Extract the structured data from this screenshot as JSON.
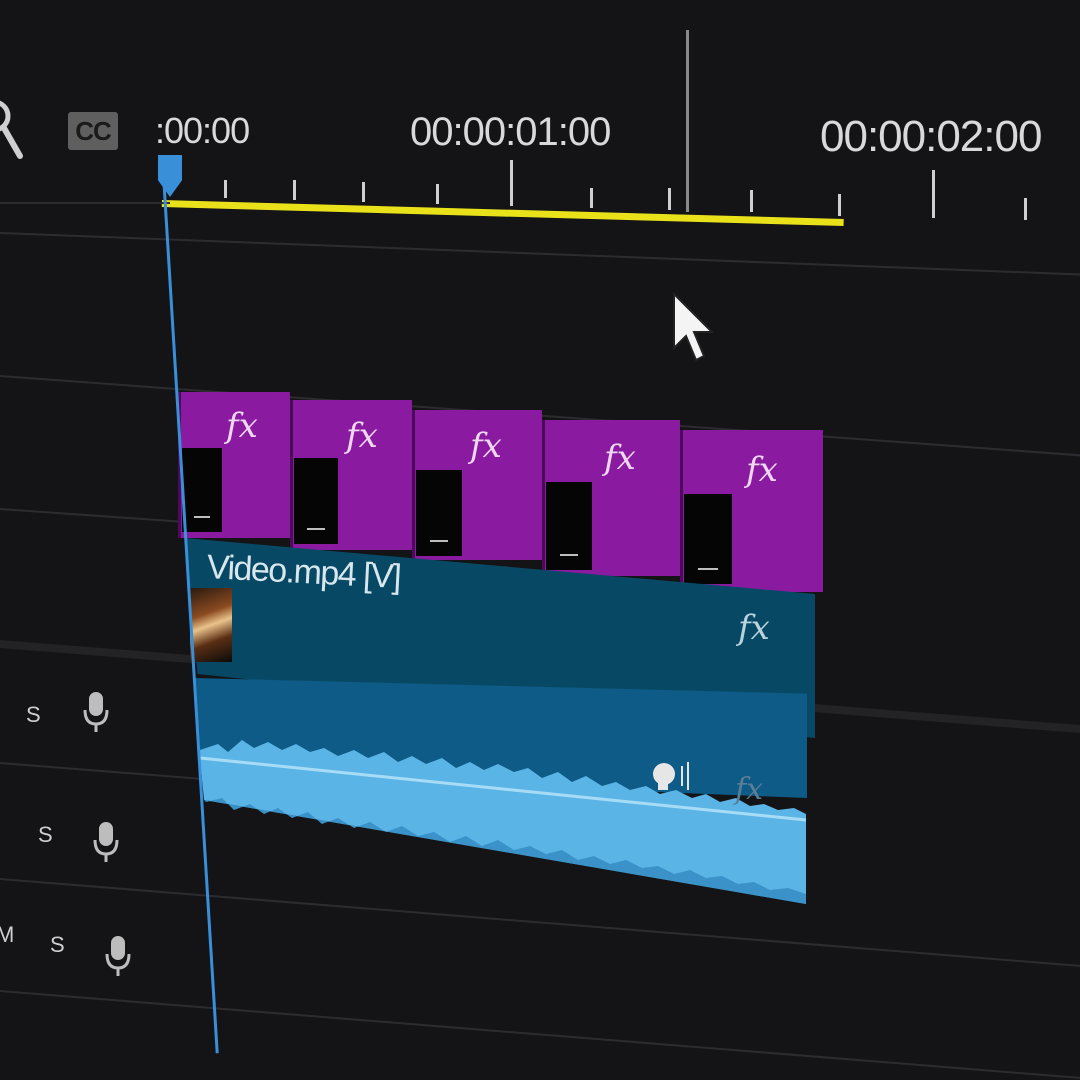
{
  "header": {
    "cc_label": "CC",
    "timecodes": [
      ":00:00",
      "00:00:01:00",
      "00:00:02:00"
    ]
  },
  "icons": {
    "tool": "magnifier-icon",
    "playhead": "playhead-marker-icon",
    "cursor": "mouse-pointer-icon",
    "mic": "microphone-icon",
    "speech": "speech-enhance-icon"
  },
  "adjustment_clips": [
    {
      "fx": "fx"
    },
    {
      "fx": "fx"
    },
    {
      "fx": "fx"
    },
    {
      "fx": "fx"
    },
    {
      "fx": "fx"
    }
  ],
  "video_clip": {
    "name": "Video.mp4 [V]",
    "fx": "fx"
  },
  "audio_clip": {
    "fx": "fx"
  },
  "track_headers": [
    {
      "solo": "S"
    },
    {
      "solo": "S"
    },
    {
      "mute": "M",
      "solo": "S"
    }
  ],
  "colors": {
    "background": "#141416",
    "playhead": "#3a8fd9",
    "work_area": "#e9e21a",
    "adjustment_clip": "#8a1aa0",
    "video_clip": "#074964",
    "audio_clip": "#0d5b86",
    "audio_waveform": "#5ab4e6"
  }
}
